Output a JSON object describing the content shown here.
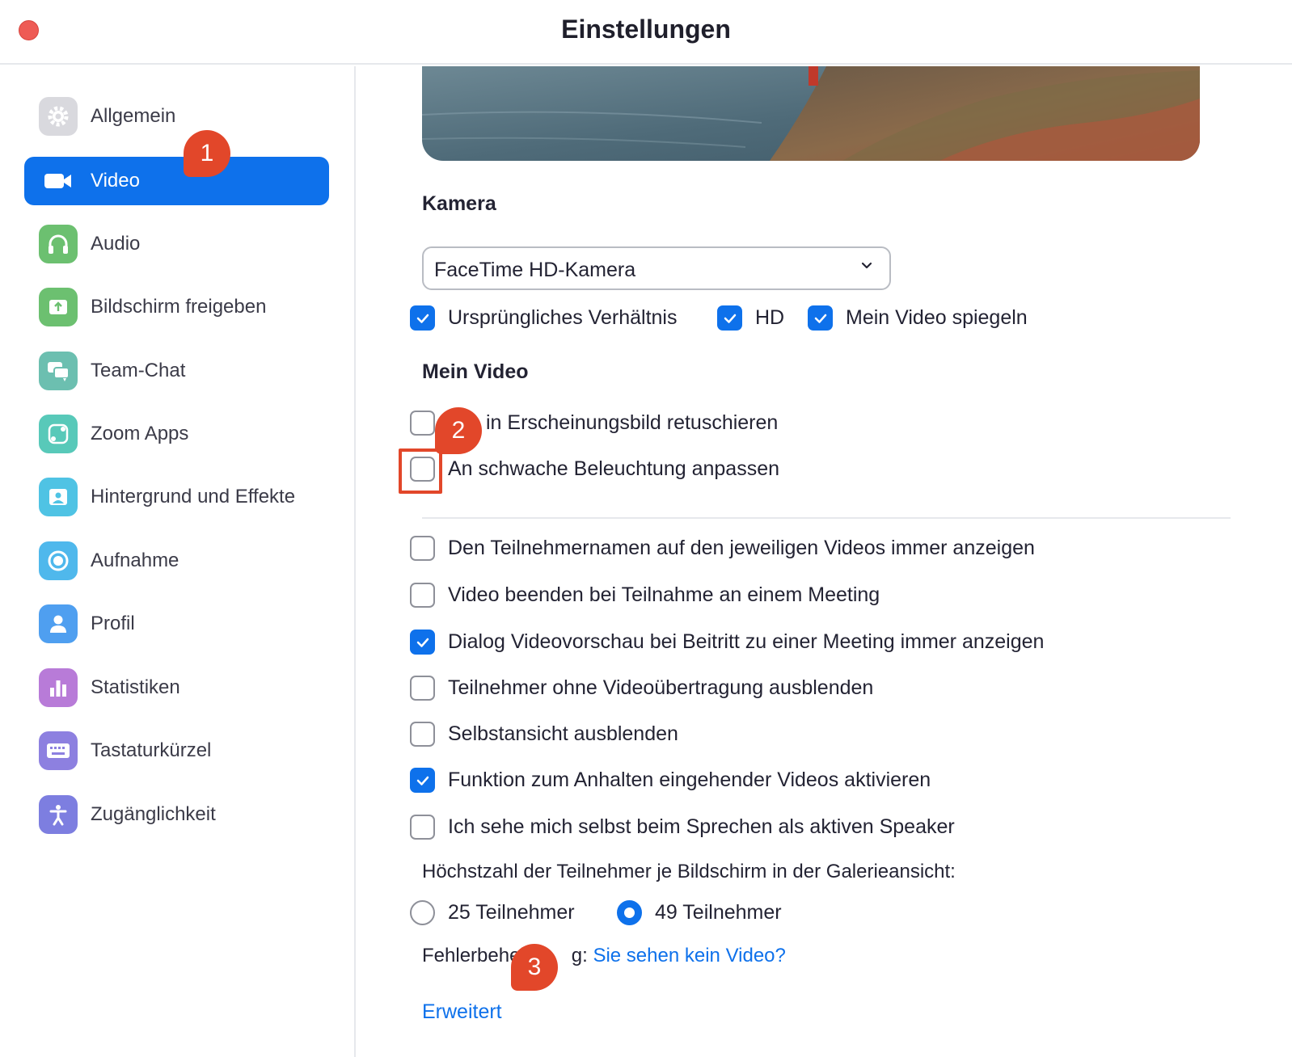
{
  "window": {
    "title": "Einstellungen"
  },
  "sidebar": {
    "items": [
      {
        "label": "Allgemein",
        "icon": "gear-icon",
        "color": "#d9d9de",
        "active": false
      },
      {
        "label": "Video",
        "icon": "video-camera-icon",
        "color": "#0e71eb",
        "active": true
      },
      {
        "label": "Audio",
        "icon": "headphones-icon",
        "color": "#6cc070",
        "active": false
      },
      {
        "label": "Bildschirm freigeben",
        "icon": "share-screen-icon",
        "color": "#6cc070",
        "active": false
      },
      {
        "label": "Team-Chat",
        "icon": "chat-icon",
        "color": "#6cbfb0",
        "active": false
      },
      {
        "label": "Zoom Apps",
        "icon": "apps-icon",
        "color": "#58c9b9",
        "active": false
      },
      {
        "label": "Hintergrund und Effekte",
        "icon": "background-icon",
        "color": "#4fc3e4",
        "active": false
      },
      {
        "label": "Aufnahme",
        "icon": "record-icon",
        "color": "#4fb8ec",
        "active": false
      },
      {
        "label": "Profil",
        "icon": "profile-icon",
        "color": "#4f9ff0",
        "active": false
      },
      {
        "label": "Statistiken",
        "icon": "statistics-icon",
        "color": "#b87bd8",
        "active": false
      },
      {
        "label": "Tastaturkürzel",
        "icon": "keyboard-icon",
        "color": "#8d80e0",
        "active": false
      },
      {
        "label": "Zugänglichkeit",
        "icon": "accessibility-icon",
        "color": "#7d7ee0",
        "active": false
      }
    ]
  },
  "camera": {
    "heading": "Kamera",
    "selected": "FaceTime HD-Kamera",
    "options": [
      {
        "label": "Ursprüngliches Verhältnis",
        "checked": true
      },
      {
        "label": "HD",
        "checked": true
      },
      {
        "label": "Mein Video spiegeln",
        "checked": true
      }
    ]
  },
  "my_video": {
    "heading": "Mein Video",
    "options": [
      {
        "label": "Mein Erscheinungsbild retuschieren",
        "visible_label": "in Erscheinungsbild retuschieren",
        "checked": false
      },
      {
        "label": "An schwache Beleuchtung anpassen",
        "checked": false
      }
    ]
  },
  "general_options": [
    {
      "label": "Den Teilnehmernamen auf den jeweiligen Videos immer anzeigen",
      "checked": false
    },
    {
      "label": "Video beenden bei Teilnahme an einem Meeting",
      "checked": false
    },
    {
      "label": "Dialog Videovorschau bei Beitritt zu einer Meeting immer anzeigen",
      "checked": true
    },
    {
      "label": "Teilnehmer ohne Videoübertragung ausblenden",
      "checked": false
    },
    {
      "label": "Selbstansicht ausblenden",
      "checked": false
    },
    {
      "label": "Funktion zum Anhalten eingehender Videos aktivieren",
      "checked": true
    },
    {
      "label": "Ich sehe mich selbst beim Sprechen als aktiven Speaker",
      "checked": false
    }
  ],
  "gallery": {
    "label": "Höchstzahl der Teilnehmer je Bildschirm in der Galerieansicht:",
    "options": [
      {
        "label": "25 Teilnehmer",
        "selected": false
      },
      {
        "label": "49 Teilnehmer",
        "selected": true
      }
    ]
  },
  "troubleshooting": {
    "prefix": "Fehlerbeheb",
    "suffix": "g:",
    "link": "Sie sehen kein Video?"
  },
  "advanced_link": "Erweitert",
  "callouts": [
    "1",
    "2",
    "3"
  ],
  "colors": {
    "accent": "#0e71eb",
    "callout": "#e2472a"
  }
}
